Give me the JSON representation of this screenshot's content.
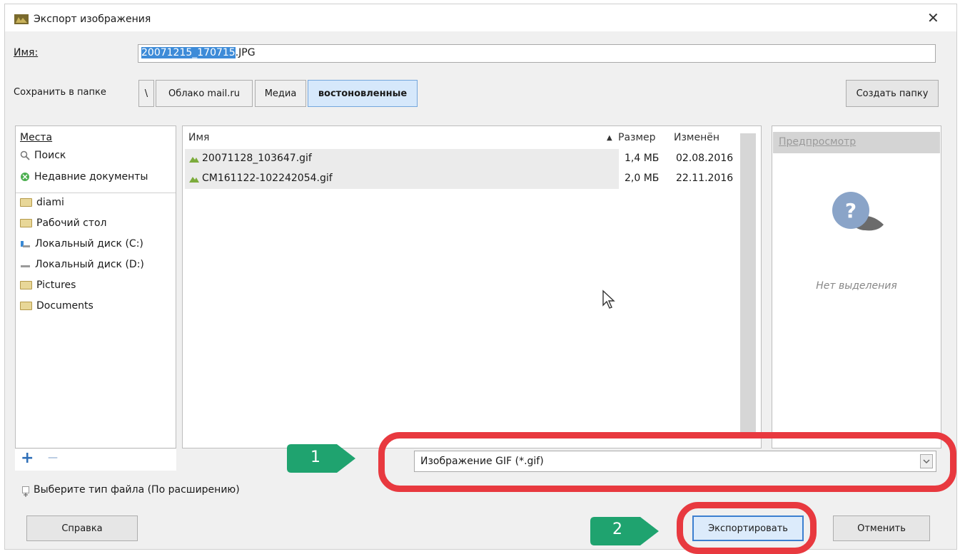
{
  "window": {
    "title": "Экспорт изображения",
    "close_label": "✕"
  },
  "name_field": {
    "label": "Имя:",
    "selected_part": "20071215_170715",
    "rest_part": ".JPG"
  },
  "save_in": {
    "label": "Сохранить в папке",
    "crumbs": [
      "\\",
      "Облако mail.ru",
      "Медиа",
      "востоновленные"
    ],
    "create_folder_label": "Создать папку"
  },
  "places": {
    "header": "Места",
    "items": [
      {
        "label": "Поиск",
        "icon": "search-icon"
      },
      {
        "label": "Недавние документы",
        "icon": "recent-icon"
      },
      {
        "label": "diami",
        "icon": "folder-icon"
      },
      {
        "label": "Рабочий стол",
        "icon": "folder-icon"
      },
      {
        "label": "Локальный диск (C:)",
        "icon": "drive-icon"
      },
      {
        "label": "Локальный диск (D:)",
        "icon": "drive-icon"
      },
      {
        "label": "Pictures",
        "icon": "folder-icon"
      },
      {
        "label": "Documents",
        "icon": "folder-icon"
      }
    ],
    "add_label": "+",
    "remove_label": "—"
  },
  "files": {
    "columns": {
      "name": "Имя",
      "size": "Размер",
      "modified": "Изменён"
    },
    "sort_indicator": "▲",
    "rows": [
      {
        "name": "20071128_103647.gif",
        "size": "1,4 МБ",
        "modified": "02.08.2016"
      },
      {
        "name": "CM161122-102242054.gif",
        "size": "2,0 МБ",
        "modified": "22.11.2016"
      }
    ]
  },
  "preview": {
    "header": "Предпросмотр",
    "no_selection": "Нет выделения"
  },
  "file_type": {
    "select_value": "Изображение GIF (*.gif)",
    "expander_label": "Выберите тип файла (По расширению)"
  },
  "buttons": {
    "help": "Справка",
    "export": "Экспортировать",
    "cancel": "Отменить"
  },
  "markers": [
    "1",
    "2"
  ],
  "colors": {
    "callout": "#e8393f",
    "marker": "#1fa36f",
    "selection": "#3d8bd8"
  }
}
